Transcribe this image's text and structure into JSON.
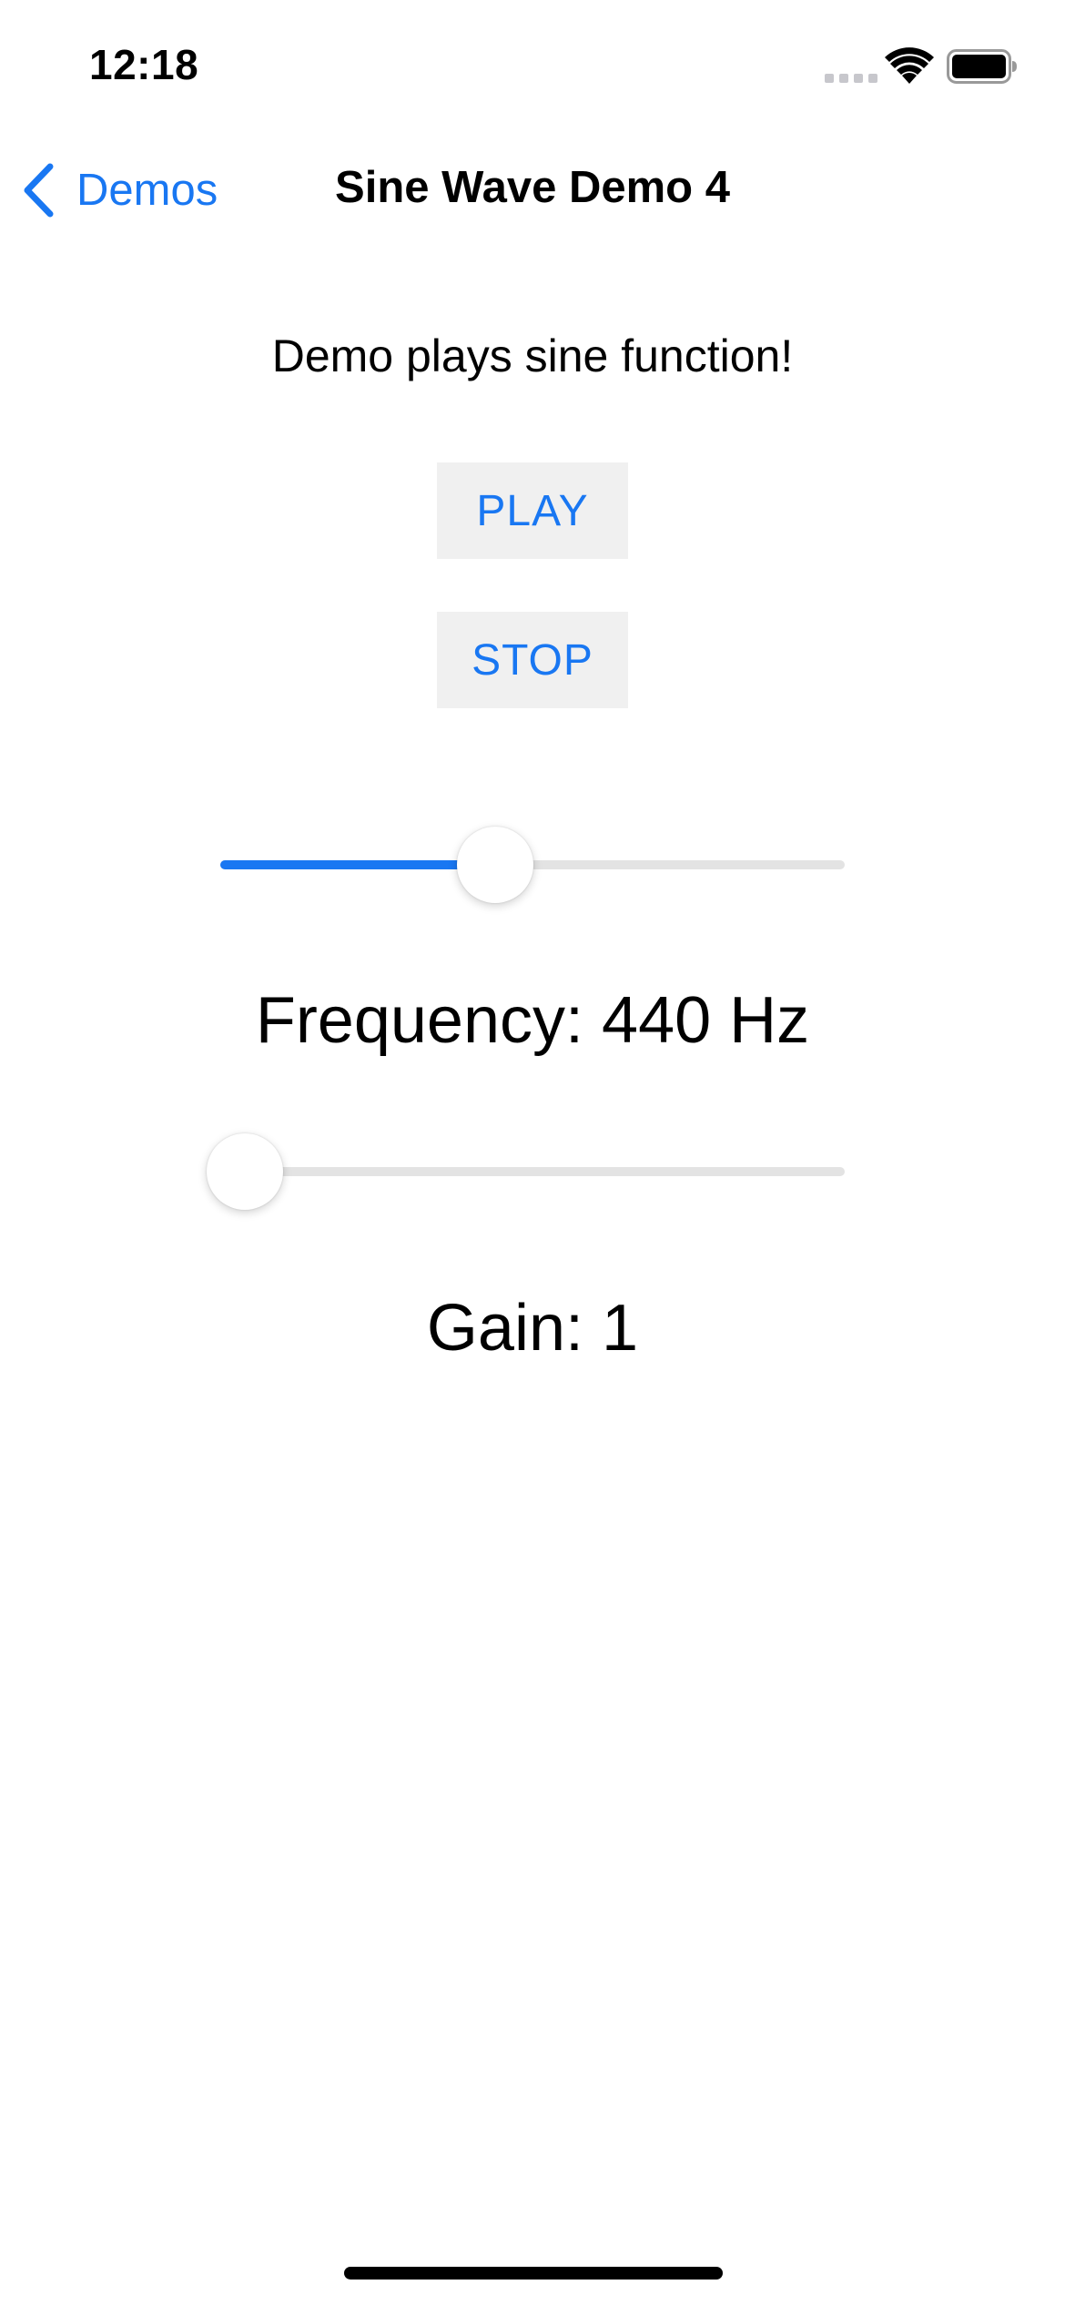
{
  "status_bar": {
    "time": "12:18",
    "icons": [
      "signal-icon",
      "wifi-icon",
      "battery-icon"
    ]
  },
  "nav": {
    "back_label": "Demos",
    "title": "Sine Wave Demo 4",
    "back_icon": "chevron-left-icon"
  },
  "main": {
    "subtitle": "Demo plays sine function!",
    "play_label": "PLAY",
    "stop_label": "STOP",
    "frequency_slider_fraction": 0.44,
    "frequency_label": "Frequency: 440 Hz",
    "gain_slider_fraction": 0.04,
    "gain_label": "Gain: 1"
  },
  "colors": {
    "accent": "#1977f2",
    "button_bg": "#f0f0f0",
    "track": "#e3e3e3",
    "text": "#000000"
  }
}
